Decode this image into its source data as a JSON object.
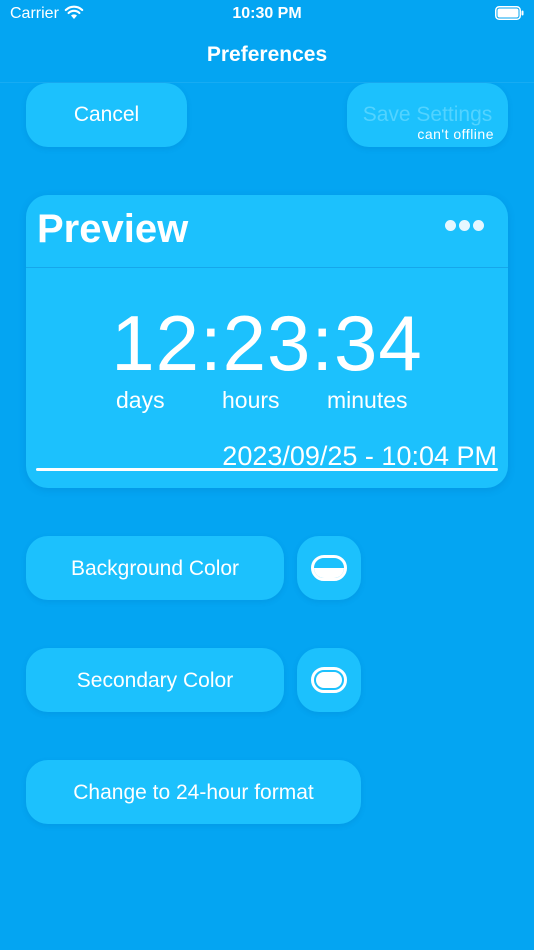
{
  "status_bar": {
    "carrier": "Carrier",
    "time": "10:30 PM",
    "icons": [
      "wifi-icon",
      "battery-icon"
    ]
  },
  "nav": {
    "title": "Preferences"
  },
  "actions": {
    "cancel_label": "Cancel",
    "save_label": "Save Settings",
    "save_sublabel": "can't offline"
  },
  "preview": {
    "title": "Preview",
    "menu_icon": "more-icon",
    "timer": "12:23:34",
    "units": {
      "days": "days",
      "hours": "hours",
      "minutes": "minutes"
    },
    "target_date": "2023/09/25 - 10:04 PM"
  },
  "settings": {
    "background_color_label": "Background Color",
    "secondary_color_label": "Secondary Color",
    "format_label": "Change to 24-hour format"
  },
  "colors": {
    "background": "#04a5f2",
    "card": "#1cc1fd",
    "text": "#ffffff",
    "disabled_text": "#52d3ff"
  }
}
